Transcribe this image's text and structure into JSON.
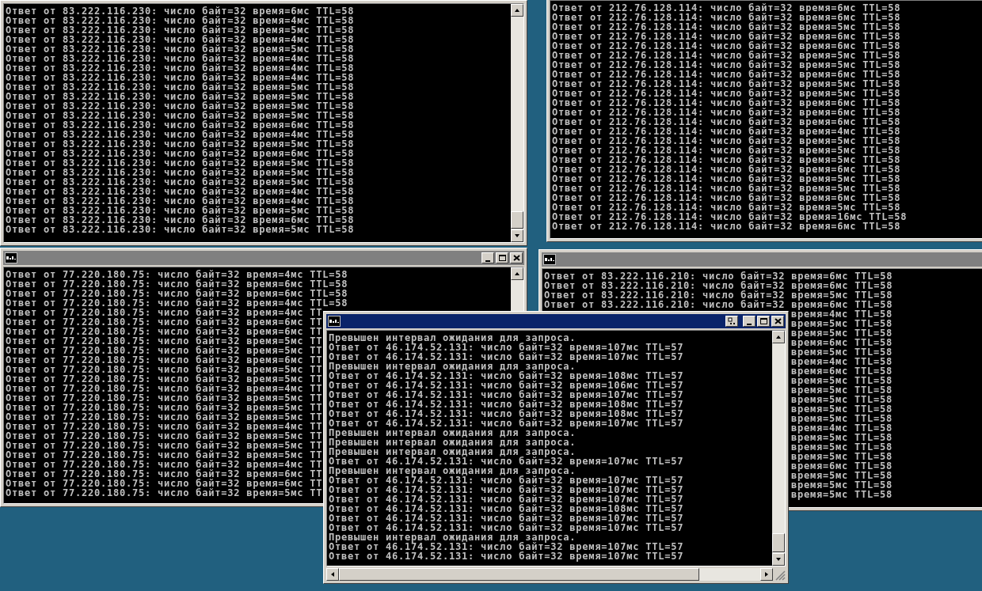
{
  "windows": [
    {
      "lines": [
        "Ответ от 83.222.116.230: число байт=32 время=6мс TTL=58",
        "Ответ от 83.222.116.230: число байт=32 время=4мс TTL=58",
        "Ответ от 83.222.116.230: число байт=32 время=5мс TTL=58",
        "Ответ от 83.222.116.230: число байт=32 время=4мс TTL=58",
        "Ответ от 83.222.116.230: число байт=32 время=5мс TTL=58",
        "Ответ от 83.222.116.230: число байт=32 время=4мс TTL=58",
        "Ответ от 83.222.116.230: число байт=32 время=4мс TTL=58",
        "Ответ от 83.222.116.230: число байт=32 время=4мс TTL=58",
        "Ответ от 83.222.116.230: число байт=32 время=5мс TTL=58",
        "Ответ от 83.222.116.230: число байт=32 время=5мс TTL=58",
        "Ответ от 83.222.116.230: число байт=32 время=5мс TTL=58",
        "Ответ от 83.222.116.230: число байт=32 время=5мс TTL=58",
        "Ответ от 83.222.116.230: число байт=32 время=6мс TTL=58",
        "Ответ от 83.222.116.230: число байт=32 время=4мс TTL=58",
        "Ответ от 83.222.116.230: число байт=32 время=5мс TTL=58",
        "Ответ от 83.222.116.230: число байт=32 время=6мс TTL=58",
        "Ответ от 83.222.116.230: число байт=32 время=5мс TTL=58",
        "Ответ от 83.222.116.230: число байт=32 время=5мс TTL=58",
        "Ответ от 83.222.116.230: число байт=32 время=5мс TTL=58",
        "Ответ от 83.222.116.230: число байт=32 время=4мс TTL=58",
        "Ответ от 83.222.116.230: число байт=32 время=4мс TTL=58",
        "Ответ от 83.222.116.230: число байт=32 время=5мс TTL=58",
        "Ответ от 83.222.116.230: число байт=32 время=6мс TTL=58",
        "Ответ от 83.222.116.230: число байт=32 время=5мс TTL=58"
      ]
    },
    {
      "lines": [
        "Ответ от 212.76.128.114: число байт=32 время=6мс TTL=58",
        "Ответ от 212.76.128.114: число байт=32 время=6мс TTL=58",
        "Ответ от 212.76.128.114: число байт=32 время=5мс TTL=58",
        "Ответ от 212.76.128.114: число байт=32 время=6мс TTL=58",
        "Ответ от 212.76.128.114: число байт=32 время=6мс TTL=58",
        "Ответ от 212.76.128.114: число байт=32 время=5мс TTL=58",
        "Ответ от 212.76.128.114: число байт=32 время=5мс TTL=58",
        "Ответ от 212.76.128.114: число байт=32 время=6мс TTL=58",
        "Ответ от 212.76.128.114: число байт=32 время=5мс TTL=58",
        "Ответ от 212.76.128.114: число байт=32 время=5мс TTL=58",
        "Ответ от 212.76.128.114: число байт=32 время=6мс TTL=58",
        "Ответ от 212.76.128.114: число байт=32 время=6мс TTL=58",
        "Ответ от 212.76.128.114: число байт=32 время=6мс TTL=58",
        "Ответ от 212.76.128.114: число байт=32 время=4мс TTL=58",
        "Ответ от 212.76.128.114: число байт=32 время=5мс TTL=58",
        "Ответ от 212.76.128.114: число байт=32 время=5мс TTL=58",
        "Ответ от 212.76.128.114: число байт=32 время=5мс TTL=58",
        "Ответ от 212.76.128.114: число байт=32 время=6мс TTL=58",
        "Ответ от 212.76.128.114: число байт=32 время=5мс TTL=58",
        "Ответ от 212.76.128.114: число байт=32 время=5мс TTL=58",
        "Ответ от 212.76.128.114: число байт=32 время=6мс TTL=58",
        "Ответ от 212.76.128.114: число байт=32 время=5мс TTL=58",
        "Ответ от 212.76.128.114: число байт=32 время=16мс TTL=58",
        "Ответ от 212.76.128.114: число байт=32 время=6мс TTL=58"
      ]
    },
    {
      "title_bar": {
        "active": false
      },
      "lines": [
        "Ответ от 77.220.180.75: число байт=32 время=4мс TTL=58",
        "Ответ от 77.220.180.75: число байт=32 время=6мс TTL=58",
        "Ответ от 77.220.180.75: число байт=32 время=6мс TTL=58",
        "Ответ от 77.220.180.75: число байт=32 время=4мс TTL=58",
        "Ответ от 77.220.180.75: число байт=32 время=4мс TT",
        "Ответ от 77.220.180.75: число байт=32 время=6мс TT",
        "Ответ от 77.220.180.75: число байт=32 время=6мс TT",
        "Ответ от 77.220.180.75: число байт=32 время=5мс TT",
        "Ответ от 77.220.180.75: число байт=32 время=5мс TT",
        "Ответ от 77.220.180.75: число байт=32 время=6мс TT",
        "Ответ от 77.220.180.75: число байт=32 время=5мс TT",
        "Ответ от 77.220.180.75: число байт=32 время=5мс TT",
        "Ответ от 77.220.180.75: число байт=32 время=4мс TT",
        "Ответ от 77.220.180.75: число байт=32 время=5мс TT",
        "Ответ от 77.220.180.75: число байт=32 время=5мс TT",
        "Ответ от 77.220.180.75: число байт=32 время=5мс TT",
        "Ответ от 77.220.180.75: число байт=32 время=4мс TT",
        "Ответ от 77.220.180.75: число байт=32 время=5мс TT",
        "Ответ от 77.220.180.75: число байт=32 время=5мс TT",
        "Ответ от 77.220.180.75: число байт=32 время=5мс TT",
        "Ответ от 77.220.180.75: число байт=32 время=4мс TT",
        "Ответ от 77.220.180.75: число байт=32 время=6мс TT",
        "Ответ от 77.220.180.75: число байт=32 время=6мс TT",
        "Ответ от 77.220.180.75: число байт=32 время=5мс TT"
      ]
    },
    {
      "title_bar": {
        "active": false
      },
      "lines": [
        {
          "kind": "full",
          "text": "Ответ от 83.222.116.210: число байт=32 время=6мс TTL=58"
        },
        {
          "kind": "full",
          "text": "Ответ от 83.222.116.210: число байт=32 время=6мс TTL=58"
        },
        {
          "kind": "full",
          "text": "Ответ от 83.222.116.210: число байт=32 время=5мс TTL=58"
        },
        {
          "kind": "full",
          "text": "Ответ от 83.222.116.210: число байт=32 время=6мс TTL=58"
        },
        {
          "kind": "tail",
          "text": "время=4мс TTL=58"
        },
        {
          "kind": "tail",
          "text": "время=5мс TTL=58"
        },
        {
          "kind": "tail",
          "text": "время=5мс TTL=58"
        },
        {
          "kind": "tail",
          "text": "время=6мс TTL=58"
        },
        {
          "kind": "tail",
          "text": "время=5мс TTL=58"
        },
        {
          "kind": "tail",
          "text": "время=4мс TTL=58"
        },
        {
          "kind": "tail",
          "text": "время=6мс TTL=58"
        },
        {
          "kind": "tail",
          "text": "время=5мс TTL=58"
        },
        {
          "kind": "tail",
          "text": "время=5мс TTL=58"
        },
        {
          "kind": "tail",
          "text": "время=5мс TTL=58"
        },
        {
          "kind": "tail",
          "text": "время=5мс TTL=58"
        },
        {
          "kind": "tail",
          "text": "время=5мс TTL=58"
        },
        {
          "kind": "tail",
          "text": "время=4мс TTL=58"
        },
        {
          "kind": "tail",
          "text": "время=5мс TTL=58"
        },
        {
          "kind": "tail",
          "text": "время=5мс TTL=58"
        },
        {
          "kind": "tail",
          "text": "время=5мс TTL=58"
        },
        {
          "kind": "tail",
          "text": "время=6мс TTL=58"
        },
        {
          "kind": "tail",
          "text": "время=5мс TTL=58"
        },
        {
          "kind": "tail",
          "text": "время=5мс TTL=58"
        },
        {
          "kind": "tail",
          "text": "время=5мс TTL=58"
        }
      ]
    },
    {
      "title_bar": {
        "active": true
      },
      "lines": [
        "Превышен интервал ожидания для запроса.",
        "Ответ от 46.174.52.131: число байт=32 время=107мс TTL=57",
        "Ответ от 46.174.52.131: число байт=32 время=107мс TTL=57",
        "Превышен интервал ожидания для запроса.",
        "Ответ от 46.174.52.131: число байт=32 время=108мс TTL=57",
        "Ответ от 46.174.52.131: число байт=32 время=106мс TTL=57",
        "Ответ от 46.174.52.131: число байт=32 время=107мс TTL=57",
        "Ответ от 46.174.52.131: число байт=32 время=108мс TTL=57",
        "Ответ от 46.174.52.131: число байт=32 время=108мс TTL=57",
        "Ответ от 46.174.52.131: число байт=32 время=107мс TTL=57",
        "Превышен интервал ожидания для запроса.",
        "Превышен интервал ожидания для запроса.",
        "Превышен интервал ожидания для запроса.",
        "Ответ от 46.174.52.131: число байт=32 время=107мс TTL=57",
        "Превышен интервал ожидания для запроса.",
        "Ответ от 46.174.52.131: число байт=32 время=107мс TTL=57",
        "Ответ от 46.174.52.131: число байт=32 время=107мс TTL=57",
        "Ответ от 46.174.52.131: число байт=32 время=107мс TTL=57",
        "Ответ от 46.174.52.131: число байт=32 время=108мс TTL=57",
        "Ответ от 46.174.52.131: число байт=32 время=107мс TTL=57",
        "Ответ от 46.174.52.131: число байт=32 время=107мс TTL=57",
        "Превышен интервал ожидания для запроса.",
        "Ответ от 46.174.52.131: число байт=32 время=107мс TTL=57",
        "Ответ от 46.174.52.131: число байт=32 время=107мс TTL=57"
      ]
    }
  ]
}
